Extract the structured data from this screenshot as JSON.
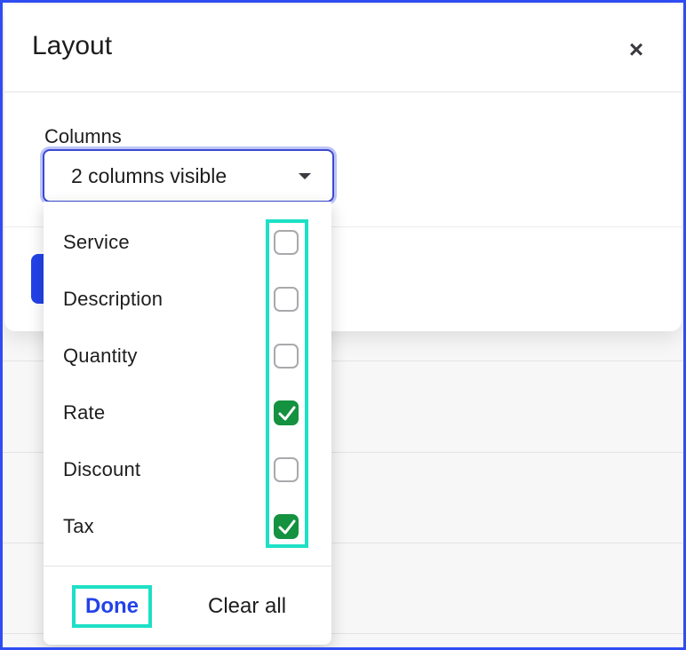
{
  "modal": {
    "title": "Layout",
    "close_glyph": "×",
    "close_icon": "close-icon"
  },
  "columns_field": {
    "label": "Columns",
    "selected_value": "2 columns visible",
    "caret_icon": "caret-down-icon"
  },
  "dropdown": {
    "options": [
      {
        "label": "Service",
        "checked": false
      },
      {
        "label": "Description",
        "checked": false
      },
      {
        "label": "Quantity",
        "checked": false
      },
      {
        "label": "Rate",
        "checked": true
      },
      {
        "label": "Discount",
        "checked": false
      },
      {
        "label": "Tax",
        "checked": true
      }
    ],
    "done_label": "Done",
    "clear_label": "Clear all"
  },
  "colors": {
    "accent": "#2342e8",
    "checked": "#14923f",
    "highlight": "#1de0c6",
    "frame": "#2f4cf2"
  }
}
